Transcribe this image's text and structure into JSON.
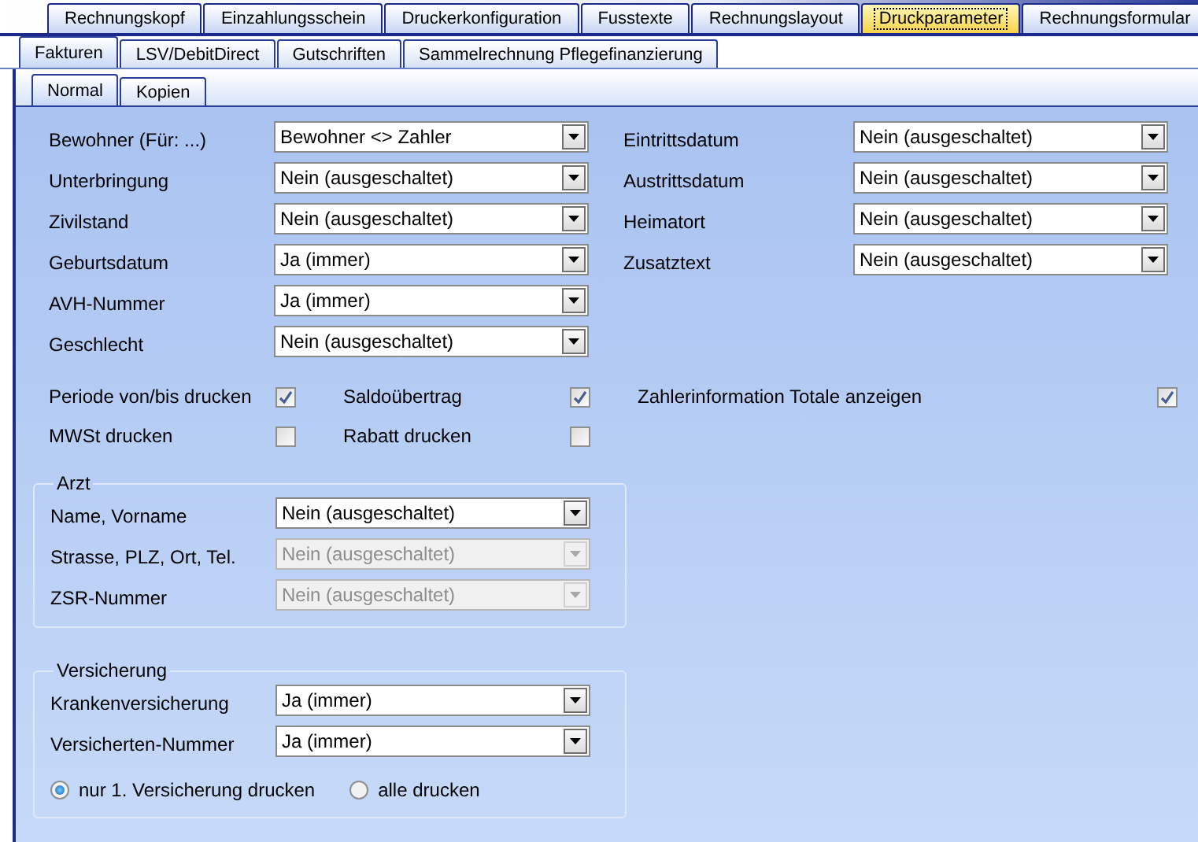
{
  "main_tabs": [
    {
      "label": "Rechnungskopf",
      "selected": false
    },
    {
      "label": "Einzahlungsschein",
      "selected": false
    },
    {
      "label": "Druckerkonfiguration",
      "selected": false
    },
    {
      "label": "Fusstexte",
      "selected": false
    },
    {
      "label": "Rechnungslayout",
      "selected": false
    },
    {
      "label": "Druckparameter",
      "selected": true
    },
    {
      "label": "Rechnungsformular",
      "selected": false
    }
  ],
  "sub_tabs": [
    {
      "label": "Fakturen",
      "selected": true
    },
    {
      "label": "LSV/DebitDirect",
      "selected": false
    },
    {
      "label": "Gutschriften",
      "selected": false
    },
    {
      "label": "Sammelrechnung Pflegefinanzierung",
      "selected": false
    }
  ],
  "inner_tabs": [
    {
      "label": "Normal",
      "selected": true
    },
    {
      "label": "Kopien",
      "selected": false
    }
  ],
  "fields_left": [
    {
      "label": "Bewohner (Für: ...)",
      "value": "Bewohner <> Zahler",
      "disabled": false
    },
    {
      "label": "Unterbringung",
      "value": "Nein (ausgeschaltet)",
      "disabled": false
    },
    {
      "label": "Zivilstand",
      "value": "Nein (ausgeschaltet)",
      "disabled": false
    },
    {
      "label": "Geburtsdatum",
      "value": "Ja (immer)",
      "disabled": false
    },
    {
      "label": "AVH-Nummer",
      "value": "Ja (immer)",
      "disabled": false
    },
    {
      "label": "Geschlecht",
      "value": "Nein (ausgeschaltet)",
      "disabled": false
    }
  ],
  "fields_right": [
    {
      "label": "Eintrittsdatum",
      "value": "Nein (ausgeschaltet)",
      "disabled": false
    },
    {
      "label": "Austrittsdatum",
      "value": "Nein (ausgeschaltet)",
      "disabled": false
    },
    {
      "label": "Heimatort",
      "value": "Nein (ausgeschaltet)",
      "disabled": false
    },
    {
      "label": "Zusatztext",
      "value": "Nein (ausgeschaltet)",
      "disabled": false
    }
  ],
  "options": [
    {
      "label": "Periode von/bis drucken",
      "checked": true
    },
    {
      "label": "Saldoübertrag",
      "checked": true
    },
    {
      "label": "Zahlerinformation Totale anzeigen",
      "checked": true
    },
    {
      "label": "MWSt drucken",
      "checked": false
    },
    {
      "label": "Rabatt drucken",
      "checked": false
    }
  ],
  "arzt": {
    "title": "Arzt",
    "fields": [
      {
        "label": "Name, Vorname",
        "value": "Nein (ausgeschaltet)",
        "disabled": false
      },
      {
        "label": "Strasse, PLZ, Ort, Tel.",
        "value": "Nein (ausgeschaltet)",
        "disabled": true
      },
      {
        "label": "ZSR-Nummer",
        "value": "Nein (ausgeschaltet)",
        "disabled": true
      }
    ]
  },
  "versicherung": {
    "title": "Versicherung",
    "fields": [
      {
        "label": "Krankenversicherung",
        "value": "Ja (immer)",
        "disabled": false
      },
      {
        "label": "Versicherten-Nummer",
        "value": "Ja (immer)",
        "disabled": false
      }
    ],
    "choices": [
      {
        "label": "nur 1. Versicherung drucken",
        "selected": true
      },
      {
        "label": "alle drucken",
        "selected": false
      }
    ]
  }
}
